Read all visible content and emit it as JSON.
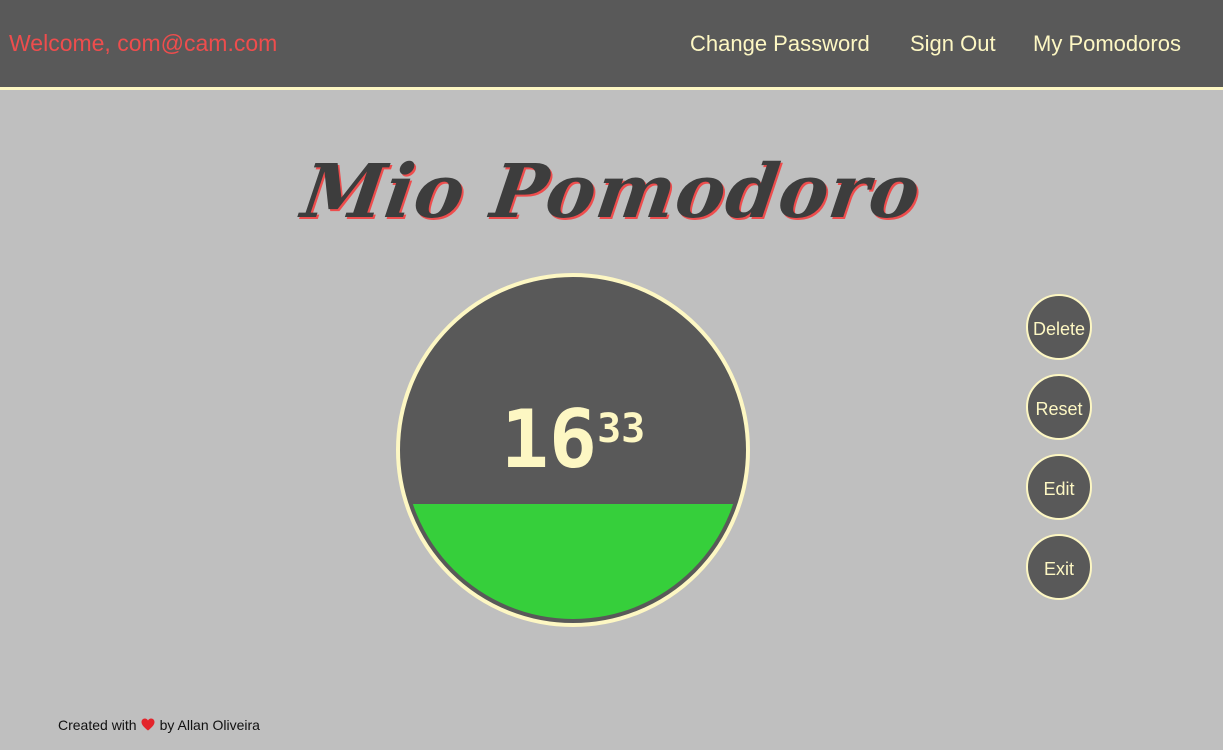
{
  "header": {
    "welcome": "Welcome, com@cam.com",
    "nav": [
      {
        "label": "Change Password"
      },
      {
        "label": "Sign Out"
      },
      {
        "label": "My Pomodoros"
      }
    ]
  },
  "title": "Mio Pomodoro",
  "timer": {
    "minutes": "16",
    "seconds": "33",
    "progress_fraction": 0.34
  },
  "actions": [
    {
      "label": "Delete"
    },
    {
      "label": "Reset"
    },
    {
      "label": "Edit"
    },
    {
      "label": "Exit"
    }
  ],
  "footer": {
    "prefix": "Created with",
    "heart_icon": "heart-icon",
    "suffix": "by Allan Oliveira"
  },
  "colors": {
    "header_bg": "#595959",
    "page_bg": "#bfbfbf",
    "accent_cream": "#fdf7c3",
    "welcome_red": "#ee4d4d",
    "progress_green": "#36cf3b"
  }
}
